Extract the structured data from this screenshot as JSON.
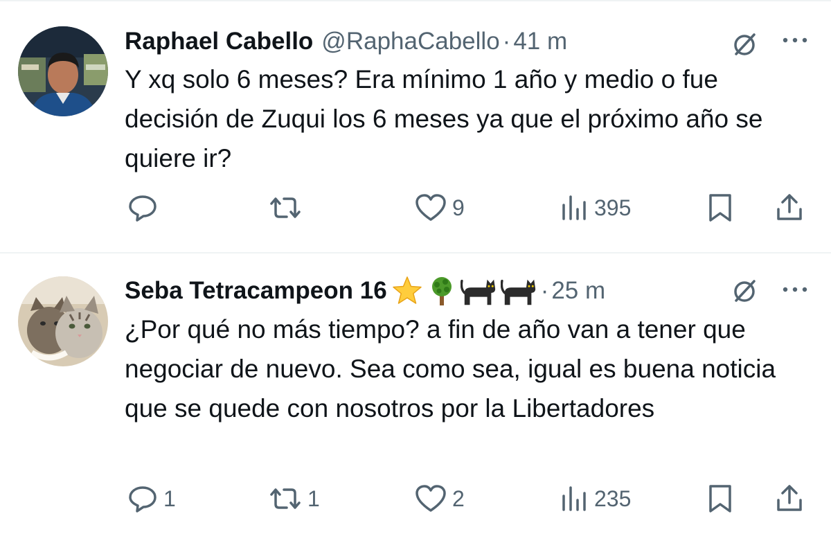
{
  "tweets": [
    {
      "author": "Raphael Cabello",
      "handle": "@RaphaCabello",
      "separator": "·",
      "time": "41 m",
      "text": "Y xq solo 6 meses? Era mínimo 1 año y medio o fue decisión de Zuqui los 6 meses ya que el próximo año se quiere ir?",
      "replies": "",
      "retweets": "",
      "likes": "9",
      "views": "395"
    },
    {
      "author": "Seba Tetracampeon 16",
      "emojis": [
        "⭐",
        "🌳",
        "🐈‍⬛",
        "🐈‍⬛"
      ],
      "separator": "·",
      "time": "25 m",
      "text": "¿Por qué no más tiempo? a fin de año van a tener que negociar de nuevo. Sea como sea, igual es buena noticia que se quede con nosotros por la Libertadores",
      "replies": "1",
      "retweets": "1",
      "likes": "2",
      "views": "235"
    }
  ],
  "icons": {
    "reply": "speech-bubble-icon",
    "retweet": "retweet-arrows-icon",
    "like": "heart-icon",
    "views": "bar-chart-icon",
    "bookmark": "bookmark-icon",
    "share": "share-upload-icon",
    "grok": "slashed-circle-icon",
    "more": "three-dots-icon"
  },
  "colors": {
    "text": "#0f1419",
    "secondary": "#536471",
    "divider": "#eff3f4"
  }
}
